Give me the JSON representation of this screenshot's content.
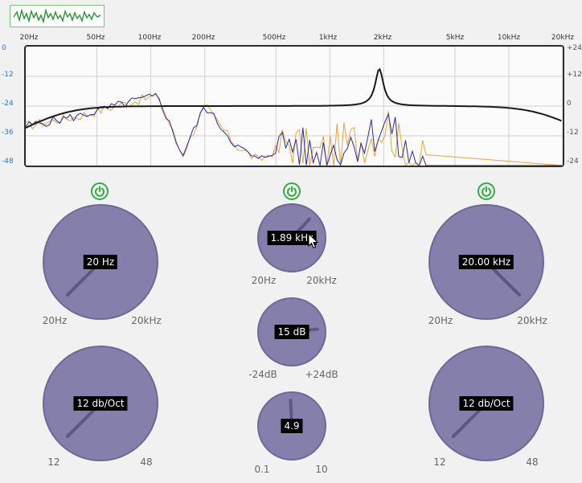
{
  "frequency_axis": [
    "20Hz",
    "50Hz",
    "100Hz",
    "200Hz",
    "500Hz",
    "1kHz",
    "2kHz",
    "5kHz",
    "10kHz",
    "20kHz"
  ],
  "db_axis_left": [
    "0",
    "-12",
    "-24",
    "-36",
    "-48"
  ],
  "db_axis_right": [
    "+24",
    "+12",
    "0",
    "-12",
    "-24"
  ],
  "colors": {
    "knob": "#857fab",
    "power": "#3aa64a",
    "eq_curve": "#1a1a1a",
    "spectrum_blue": "#2a2aa8",
    "spectrum_orange": "#e6a63a"
  },
  "eq_curve": {
    "lowcut_hz": 20,
    "highcut_hz": 20000,
    "peak_hz": 1890,
    "peak_gain_db": 15,
    "q": 4.9
  },
  "bands": {
    "low": {
      "power": "on",
      "freq": {
        "value": "20 Hz",
        "min": "20Hz",
        "max": "20kHz",
        "level": 0.0
      },
      "slope": {
        "value": "12 db/Oct",
        "min": "12",
        "max": "48",
        "level": 0.0
      }
    },
    "mid": {
      "power": "on",
      "freq": {
        "value": "1.89 kHz",
        "min": "20Hz",
        "max": "20kHz",
        "level": 0.66
      },
      "gain": {
        "value": "15 dB",
        "min": "-24dB",
        "max": "+24dB",
        "level": 0.81
      },
      "q": {
        "value": "4.9",
        "min": "0.1",
        "max": "10",
        "level": 0.49
      }
    },
    "high": {
      "power": "on",
      "freq": {
        "value": "20.00 kHz",
        "min": "20Hz",
        "max": "20kHz",
        "level": 1.0
      },
      "slope": {
        "value": "12 db/Oct",
        "min": "12",
        "max": "48",
        "level": 0.0
      }
    }
  }
}
